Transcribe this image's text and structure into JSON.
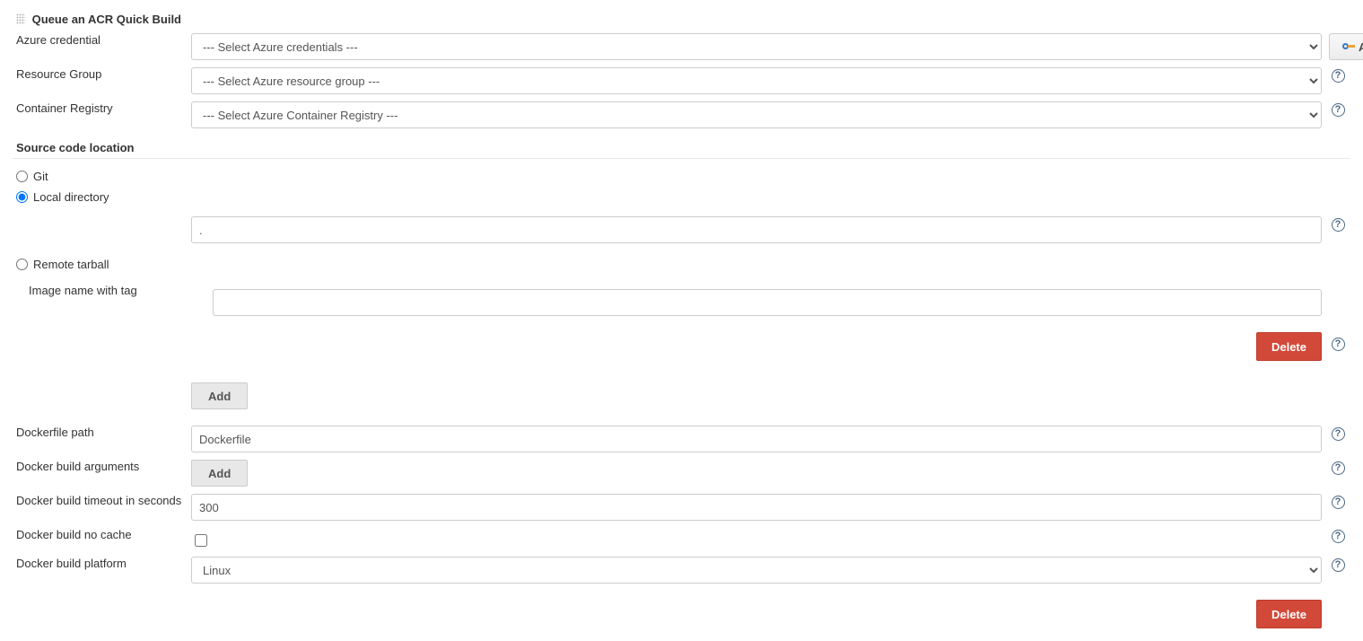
{
  "header": {
    "title": "Queue an ACR Quick Build"
  },
  "labels": {
    "azure_credential": "Azure credential",
    "resource_group": "Resource Group",
    "container_registry": "Container Registry",
    "source_location": "Source code location",
    "image_name_tag": "Image name with tag",
    "dockerfile_path": "Dockerfile path",
    "build_args": "Docker build arguments",
    "build_timeout": "Docker build timeout in seconds",
    "build_no_cache": "Docker build no cache",
    "build_platform": "Docker build platform"
  },
  "options": {
    "azure_credential_selected": "--- Select Azure credentials ---",
    "resource_group_selected": "--- Select Azure resource group ---",
    "container_registry_selected": "--- Select Azure Container Registry ---",
    "platform_selected": "Linux"
  },
  "radios": {
    "git": "Git",
    "local_directory": "Local directory",
    "remote_tarball": "Remote tarball",
    "selected": "local_directory"
  },
  "values": {
    "local_directory": ".",
    "image_name_tag": "",
    "dockerfile_path": "Dockerfile",
    "build_timeout": "300",
    "no_cache": false
  },
  "buttons": {
    "add_cred": "Add",
    "add": "Add",
    "delete": "Delete"
  }
}
